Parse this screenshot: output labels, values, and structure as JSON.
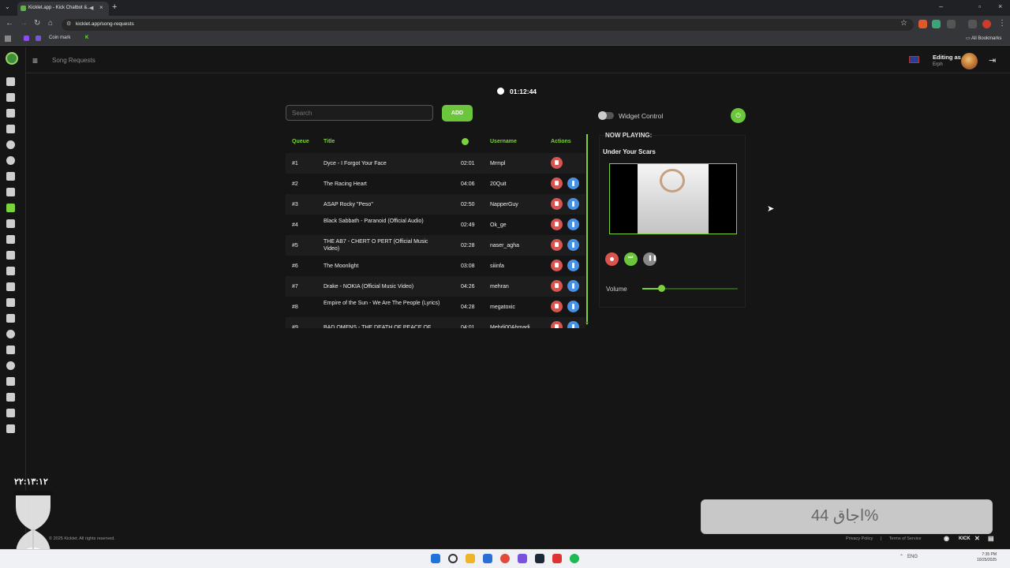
{
  "browser": {
    "tab_title": "Kicklet.app - Kick Chatbot &...",
    "url": "kicklet.app/song-requests",
    "bookmarks": [
      "Coin mark",
      "K"
    ],
    "all_bookmarks": "All Bookmarks"
  },
  "app": {
    "page_title": "Song Requests",
    "editing_label": "Editing as",
    "editing_user": "Erph",
    "timer": "01:12:44",
    "search_placeholder": "Search",
    "add_label": "ADD",
    "columns": [
      "Queue",
      "Title",
      "Username",
      "Actions"
    ],
    "queue": [
      {
        "pos": "#1",
        "title": "Dyce - I Forgot Your Face",
        "duration": "02:01",
        "user": "Mrmpl"
      },
      {
        "pos": "#2",
        "title": "The Racing Heart",
        "duration": "04:06",
        "user": "20Quit"
      },
      {
        "pos": "#3",
        "title": "ASAP Rocky \"Peso\"",
        "duration": "02:50",
        "user": "NapperGuy"
      },
      {
        "pos": "#4",
        "title": "Black Sabbath - Paranoid (Official Audio)",
        "duration": "02:49",
        "user": "Ok_ge"
      },
      {
        "pos": "#5",
        "title": "THE AB7 - CHERT O PERT (Official Music Video)",
        "duration": "02:28",
        "user": "naser_agha"
      },
      {
        "pos": "#6",
        "title": "The Moonlight",
        "duration": "03:08",
        "user": "siiinfa"
      },
      {
        "pos": "#7",
        "title": "Drake - NOKIA (Official Music Video)",
        "duration": "04:26",
        "user": "mehran"
      },
      {
        "pos": "#8",
        "title": "Empire of the Sun - We Are The People (Lyrics)",
        "duration": "04:28",
        "user": "megatoxic"
      },
      {
        "pos": "#9",
        "title": "BAD OMENS - THE DEATH OF PEACE OF MIND",
        "duration": "04:01",
        "user": "Mehdi00Ahmadi"
      }
    ],
    "widget_control": "Widget Control",
    "now_playing_label": "NOW PLAYING:",
    "now_playing_title": "Under Your Scars",
    "volume_label": "Volume",
    "volume_level": 0.2,
    "copyright": "© 2025 Kicklet. All rights reserved.",
    "privacy": "Privacy Policy",
    "terms": "Terms of Service",
    "footer_sep": "|"
  },
  "overlay": {
    "clock": "۲۲:۱۳:۱۲",
    "box_text": "اجاق 44%"
  },
  "taskbar": {
    "lang": "ENG",
    "time": "7:35 PM",
    "date": "10/25/2025"
  },
  "colors": {
    "accent": "#7bd23a",
    "delete": "#d9534f",
    "move_up": "#4a90e2"
  },
  "icons": {
    "sidebar": [
      "dashboard-icon",
      "clipboard-icon",
      "commands-icon",
      "tools-icon",
      "chat-icon",
      "timer-icon",
      "shield-icon",
      "alert-icon",
      "music-icon",
      "star-icon",
      "gift-icon",
      "cart-icon",
      "link-icon",
      "chart-icon",
      "video-icon",
      "package-icon",
      "emoji-icon",
      "clapper-icon",
      "message-icon",
      "monitor-icon",
      "search-icon",
      "discord-icon",
      "id-card-icon"
    ]
  }
}
